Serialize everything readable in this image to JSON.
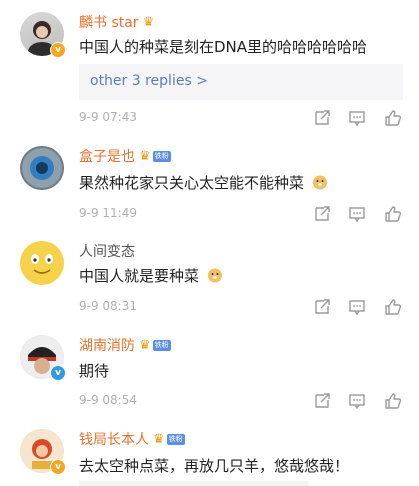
{
  "comments": [
    {
      "name": "麟书 star",
      "text": "中国人的种菜是刻在DNA里的哈哈哈哈哈哈",
      "replies_link": "other 3 replies >",
      "time": "9-9 07:43"
    },
    {
      "name": "盒子是也",
      "fan_badge": "铁粉",
      "text": "果然种花家只关心太空能不能种菜",
      "time": "9-9 11:49"
    },
    {
      "name": "人间变态",
      "text": "中国人就是要种菜",
      "time": "9-9 08:31"
    },
    {
      "name": "湖南消防",
      "fan_badge": "铁粉",
      "text": "期待",
      "time": "9-9 08:54"
    },
    {
      "name": "钱局长本人",
      "fan_badge": "铁粉",
      "text": "去太空种点菜，再放几只羊，悠哉悠哉！"
    }
  ],
  "colors": {
    "name_orange": "#e8722f",
    "link_blue": "#5b7fb5",
    "meta_gray": "#b0b0b0",
    "reply_bg": "#f5f5f7"
  },
  "icons": [
    "share-icon",
    "comment-icon",
    "like-icon",
    "crown-icon",
    "verified-badge-icon",
    "doge-emoji-icon"
  ]
}
